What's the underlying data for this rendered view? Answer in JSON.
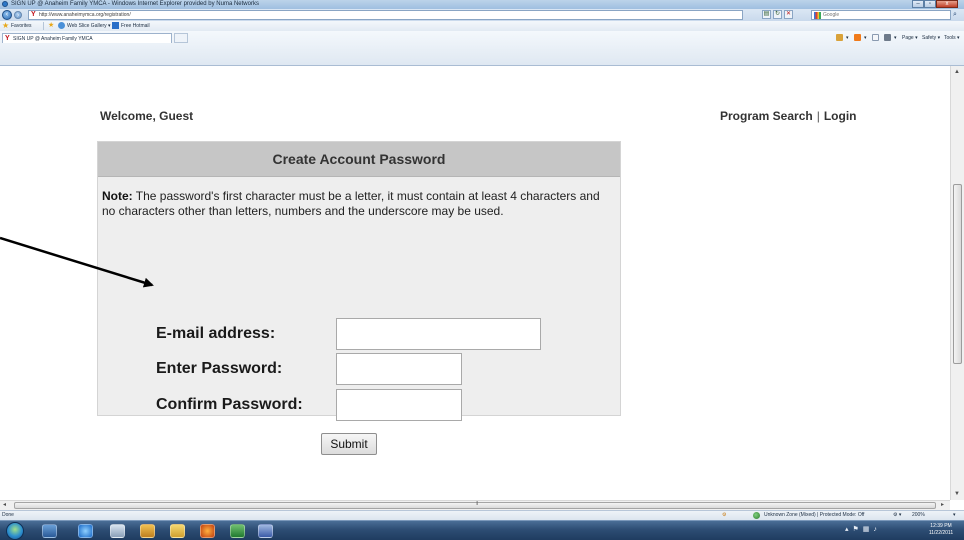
{
  "window": {
    "title": "SIGN UP @ Anaheim Family YMCA - Windows Internet Explorer provided by Numa Networks"
  },
  "address_bar": {
    "url": "http://www.anaheimymca.org/registration/",
    "search_placeholder": "Google"
  },
  "favorites_bar": {
    "favorites_label": "Favorites",
    "web_slice_label": "Web Slice Gallery ▾",
    "hotmail_label": "Free Hotmail"
  },
  "tab": {
    "label": "SIGN UP @ Anaheim Family YMCA"
  },
  "command_bar": {
    "page_label": "Page ▾",
    "safety_label": "Safety ▾",
    "tools_label": "Tools ▾"
  },
  "page": {
    "welcome": "Welcome, Guest",
    "program_search": "Program Search",
    "separator": "|",
    "login": "Login",
    "panel_title": "Create Account Password",
    "note_label": "Note:",
    "note_text": " The password's first character must be a letter, it must contain at least 4 characters and no characters other than letters, numbers and the underscore may be used.",
    "fields": {
      "email_label": "E-mail address:",
      "email_value": "",
      "password_label": "Enter Password:",
      "password_value": "",
      "confirm_label": "Confirm Password:",
      "confirm_value": ""
    },
    "submit_label": "Submit"
  },
  "status_bar": {
    "left": "Done",
    "zone": "Unknown Zone (Mixed) | Protected Mode: Off",
    "zoom": "200%"
  },
  "taskbar": {
    "time": "12:39 PM",
    "date": "11/22/2011"
  },
  "colors": {
    "panel_bg": "#eeeeee",
    "panel_header_bg": "#c6c6c6",
    "text": "#333333",
    "ymca_red": "#c0101a"
  }
}
